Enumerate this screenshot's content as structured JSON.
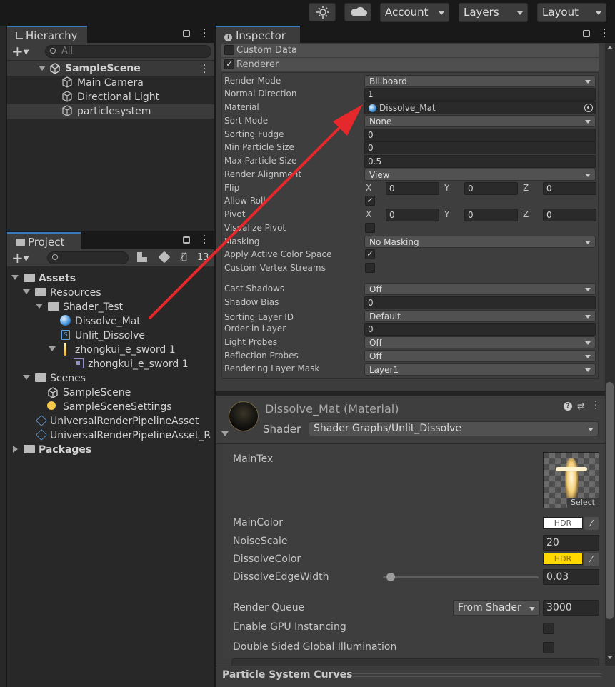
{
  "toolbar": {
    "account": "Account",
    "layers": "Layers",
    "layout": "Layout"
  },
  "hierarchy": {
    "tab": "Hierarchy",
    "search_placeholder": "All",
    "scene": "SampleScene",
    "items": [
      "Main Camera",
      "Directional Light",
      "particlesystem"
    ]
  },
  "project": {
    "tab": "Project",
    "count": "13",
    "tree": {
      "assets": "Assets",
      "resources": "Resources",
      "shader_test": "Shader_Test",
      "dissolve_mat": "Dissolve_Mat",
      "unlit_dissolve": "Unlit_Dissolve",
      "zhongkui1": "zhongkui_e_sword 1",
      "zhongkui2": "zhongkui_e_sword 1",
      "scenes": "Scenes",
      "samplescene": "SampleScene",
      "samplescenesettings": "SampleSceneSettings",
      "urp1": "UniversalRenderPipelineAsset",
      "urp2": "UniversalRenderPipelineAsset_R",
      "packages": "Packages"
    }
  },
  "inspector": {
    "tab": "Inspector",
    "custom_data": "Custom Data",
    "renderer": "Renderer",
    "rows": {
      "render_mode": [
        "Render Mode",
        "Billboard"
      ],
      "normal_direction": [
        "Normal Direction",
        "1"
      ],
      "material": [
        "Material",
        "Dissolve_Mat"
      ],
      "sort_mode": [
        "Sort Mode",
        "None"
      ],
      "sorting_fudge": [
        "Sorting Fudge",
        "0"
      ],
      "min_particle_size": [
        "Min Particle Size",
        "0"
      ],
      "max_particle_size": [
        "Max Particle Size",
        "0.5"
      ],
      "render_alignment": [
        "Render Alignment",
        "View"
      ],
      "masking": [
        "Masking",
        "No Masking"
      ],
      "cast_shadows": [
        "Cast Shadows",
        "Off"
      ],
      "shadow_bias": [
        "Shadow Bias",
        "0"
      ],
      "sorting_layer_id": [
        "Sorting Layer ID",
        "Default"
      ],
      "order_in_layer": [
        "Order in Layer",
        "0"
      ],
      "light_probes": [
        "Light Probes",
        "Off"
      ],
      "reflection_probes": [
        "Reflection Probes",
        "Off"
      ],
      "rendering_layer_mask": [
        "Rendering Layer Mask",
        "Layer1"
      ]
    },
    "flip": {
      "label": "Flip",
      "x": "0",
      "y": "0",
      "z": "0"
    },
    "pivot": {
      "label": "Pivot",
      "x": "0",
      "y": "0",
      "z": "0"
    },
    "axes": {
      "x": "X",
      "y": "Y",
      "z": "Z"
    },
    "checks": {
      "allow_roll": "Allow Roll",
      "visualize_pivot": "Visualize Pivot",
      "apply_active_color_space": "Apply Active Color Space",
      "custom_vertex_streams": "Custom Vertex Streams"
    }
  },
  "material": {
    "title": "Dissolve_Mat (Material)",
    "shader_label": "Shader",
    "shader_value": "Shader Graphs/Unlit_Dissolve",
    "maintex": "MainTex",
    "select": "Select",
    "maincolor": "MainColor",
    "hdr": "HDR",
    "noisescale": "NoiseScale",
    "noisescale_value": "20",
    "dissolvecolor": "DissolveColor",
    "dissolveedgewidth": "DissolveEdgeWidth",
    "edge_value": "0.03",
    "edge_slider": 0.03,
    "render_queue": "Render Queue",
    "render_queue_mode": "From Shader",
    "render_queue_value": "3000",
    "gpu": "Enable GPU Instancing",
    "double_sided": "Double Sided Global Illumination",
    "colors": {
      "maincolor": "#ffffff",
      "dissolvecolor": "#ffd800"
    }
  },
  "footer": "Particle System Curves"
}
